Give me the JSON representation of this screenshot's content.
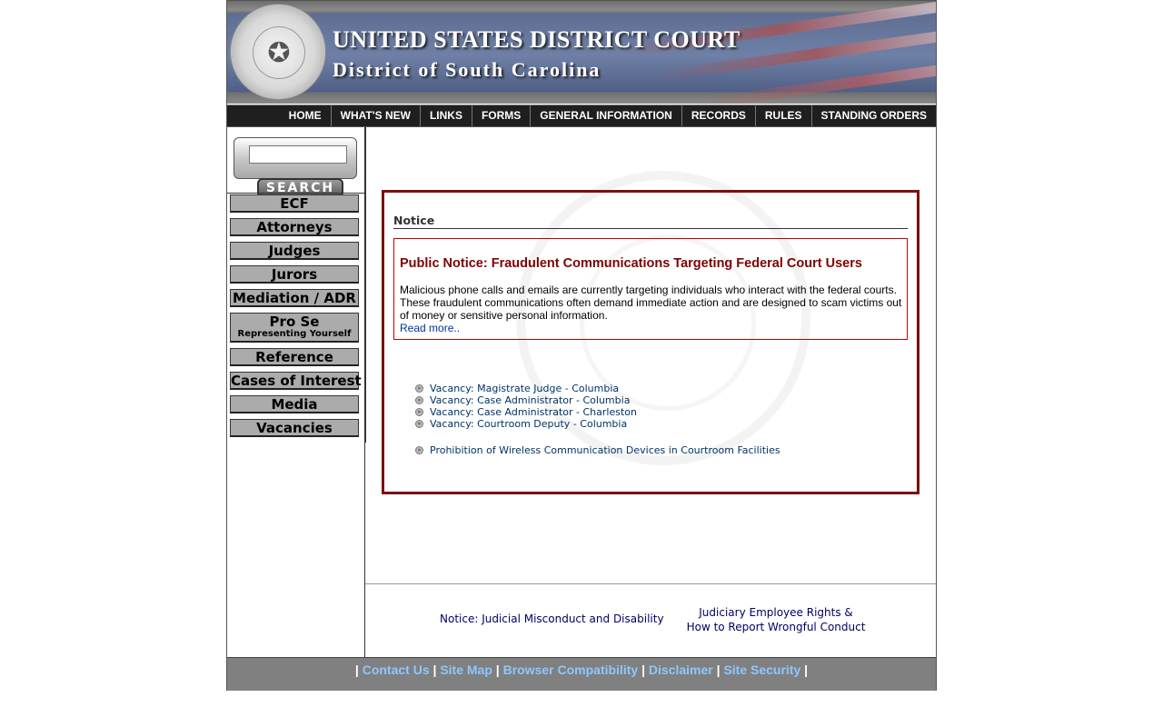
{
  "header": {
    "title": "UNITED STATES DISTRICT COURT",
    "subtitle": "District of South Carolina",
    "seal_icon": "seal-icon"
  },
  "nav": {
    "items": [
      "HOME",
      "WHAT'S NEW",
      "LINKS",
      "FORMS",
      "GENERAL INFORMATION",
      "RECORDS",
      "RULES",
      "STANDING ORDERS"
    ]
  },
  "search": {
    "placeholder": "",
    "button_label": "SEARCH"
  },
  "sidebar": {
    "buttons": [
      "ECF",
      "Attorneys",
      "Judges",
      "Jurors",
      "Mediation / ADR",
      "Pro Se",
      "Reference",
      "Cases of Interest",
      "Media",
      "Vacancies"
    ],
    "prose_sub": "Representing Yourself"
  },
  "notice": {
    "heading": "Notice",
    "alert_title": "Public Notice: Fraudulent Communications Targeting Federal Court Users",
    "alert_text": "Malicious phone calls and emails are currently targeting individuals who interact with the federal courts. These fraudulent communications often demand immediate action and are designed to scam victims out of money or sensitive personal information.",
    "read_more": "Read more..",
    "vacancies": [
      "Vacancy: Magistrate Judge - Columbia",
      "Vacancy: Case Administrator - Columbia",
      "Vacancy: Case Administrator - Charleston",
      "Vacancy: Courtroom Deputy - Columbia"
    ],
    "prohibition": "Prohibition of Wireless Communication Devices in Courtroom Facilities"
  },
  "footer_links": {
    "misconduct": "Notice: Judicial Misconduct and Disability",
    "rights_line1": "Judiciary Employee Rights &",
    "rights_line2": "How to Report Wrongful Conduct"
  },
  "bottom": {
    "sep": "|",
    "links": [
      "Contact Us",
      "Site Map",
      "Browser Compatibility",
      "Disclaimer",
      "Site Security"
    ]
  },
  "colors": {
    "notice_border": "#7a1010",
    "alert_title": "#800000",
    "link": "#003366",
    "bottom_link": "#8ec7ff"
  }
}
